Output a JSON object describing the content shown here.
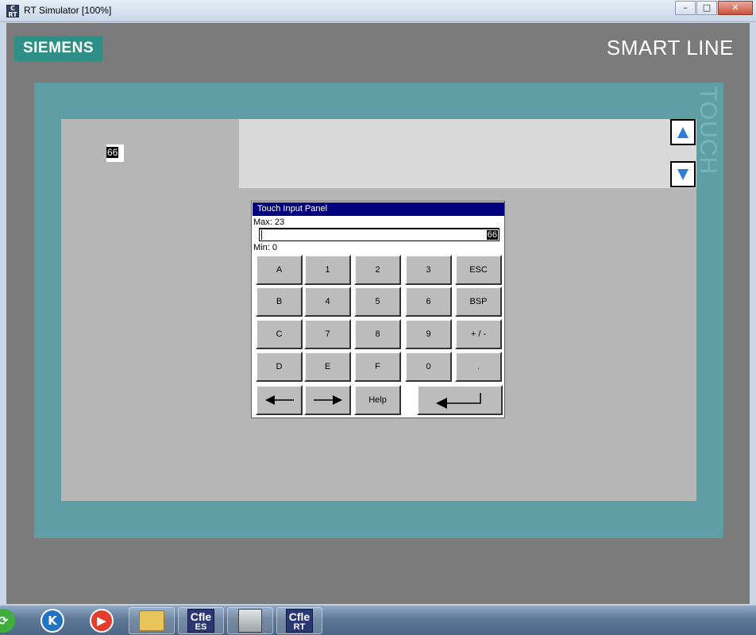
{
  "window": {
    "title": "RT Simulator [100%]",
    "app_icon_text": "Cfl RT",
    "controls": [
      "minimize",
      "maximize",
      "close"
    ]
  },
  "device": {
    "brand": "SIEMENS",
    "product_line": "SMART LINE",
    "touch_label": "TOUCH",
    "colors": {
      "bezel": "#5e9ea4",
      "brand": "#2d8f86",
      "body": "#7b7b7b"
    }
  },
  "screen": {
    "io_field_value": "66",
    "scroll_up_icon": "triangle-up-icon",
    "scroll_down_icon": "triangle-down-icon"
  },
  "touch_input_panel": {
    "title": "Touch Input Panel",
    "max_label": "Max: 23",
    "min_label": "Min:  0",
    "input_value": "66",
    "keys": [
      [
        "A",
        "1",
        "2",
        "3",
        "ESC"
      ],
      [
        "B",
        "4",
        "5",
        "6",
        "BSP"
      ],
      [
        "C",
        "7",
        "8",
        "9",
        "+ / -"
      ],
      [
        "D",
        "E",
        "F",
        "0",
        "."
      ]
    ],
    "bottom_row": {
      "left_icon": "arrow-left-icon",
      "right_icon": "arrow-right-icon",
      "help": "Help",
      "enter_icon": "enter-icon"
    },
    "colors": {
      "title_bar": "#00007e",
      "key_face": "#bcbcbc"
    }
  },
  "taskbar": {
    "items": [
      {
        "icon": "refresh-icon"
      },
      {
        "icon": "k-app-icon",
        "text": "K"
      },
      {
        "icon": "media-player-icon"
      },
      {
        "icon": "folder-icon"
      },
      {
        "icon": "cflex-es-icon",
        "text": "Cfle",
        "sub": "ES"
      },
      {
        "icon": "window-thumbnail-icon"
      },
      {
        "icon": "cflex-rt-icon",
        "text": "Cfle",
        "sub": "RT"
      }
    ]
  }
}
